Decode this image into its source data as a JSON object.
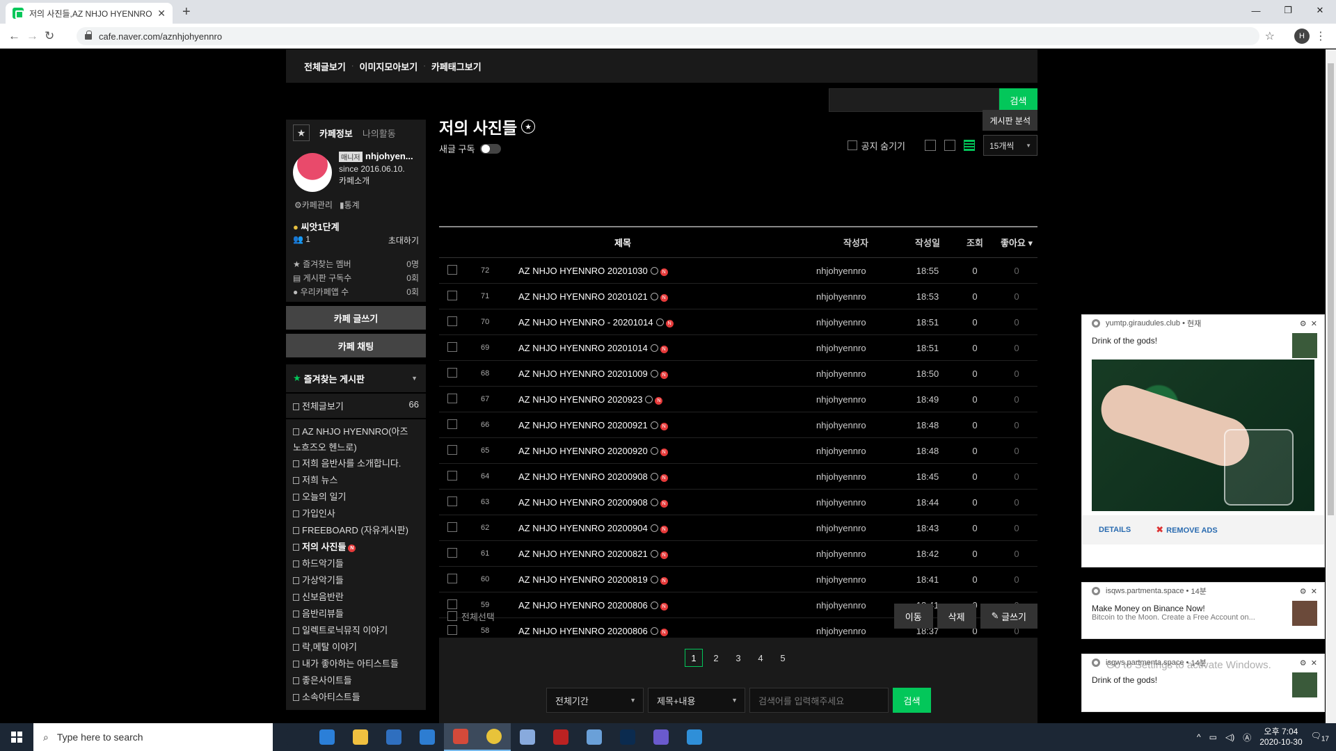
{
  "browser": {
    "tab_title": "저의 사진들,AZ NHJO HYENNRO",
    "url": "cafe.naver.com/aznhjohyennro",
    "profile_initial": "H"
  },
  "topmenu": [
    "전체글보기",
    "이미지모아보기",
    "카페태그보기"
  ],
  "top_search": {
    "button": "검색"
  },
  "sidebar": {
    "tab_info": "카페정보",
    "tab_activity": "나의활동",
    "manager_badge": "매니저",
    "manager_name": "nhjohyen...",
    "since": "since 2016.06.10.",
    "intro": "카페소개",
    "manage_link": "카페관리",
    "stats_link": "통계",
    "level": "씨앗1단계",
    "member_count": "1",
    "invite": "초대하기",
    "stats": [
      {
        "label": "즐겨찾는 멤버",
        "value": "0명"
      },
      {
        "label": "게시판 구독수",
        "value": "0회"
      },
      {
        "label": "우리카페앱 수",
        "value": "0회"
      }
    ],
    "write_button": "카페 글쓰기",
    "chat_button": "카페 채팅",
    "fav_title": "즐겨찾는 게시판",
    "all_posts": "전체글보기",
    "all_posts_count": "66",
    "boards": [
      "AZ NHJO HYENNRO(아즈 노흐즈오 헨느로)",
      "저희 음반사를 소개합니다.",
      "저희 뉴스",
      "오늘의 일기",
      "가입인사",
      "FREEBOARD (자유게시판)",
      "저의 사진들",
      "하드악기들",
      "가상악기들",
      "신보음반란",
      "음반리뷰들",
      "일렉트로닉뮤직 이야기",
      "락,메탈 이야기",
      "내가 좋아하는 아티스트들",
      "좋은사이트들",
      "소속아티스트들"
    ]
  },
  "main": {
    "board_title": "저의 사진들",
    "analysis_button": "게시판 분석",
    "subscribe_label": "새글 구독",
    "notice_hide": "공지 숨기기",
    "per_page": "15개씩",
    "headers": {
      "title": "제목",
      "author": "작성자",
      "date": "작성일",
      "views": "조회",
      "likes": "좋아요"
    },
    "rows": [
      {
        "num": "72",
        "title": "AZ NHJO HYENNRO 20201030",
        "author": "nhjohyennro",
        "date": "18:55",
        "views": "0",
        "likes": "0"
      },
      {
        "num": "71",
        "title": "AZ NHJO HYENNRO 20201021",
        "author": "nhjohyennro",
        "date": "18:53",
        "views": "0",
        "likes": "0"
      },
      {
        "num": "70",
        "title": "AZ NHJO HYENNRO - 20201014",
        "author": "nhjohyennro",
        "date": "18:51",
        "views": "0",
        "likes": "0"
      },
      {
        "num": "69",
        "title": "AZ NHJO HYENNRO 20201014",
        "author": "nhjohyennro",
        "date": "18:51",
        "views": "0",
        "likes": "0"
      },
      {
        "num": "68",
        "title": "AZ NHJO HYENNRO 20201009",
        "author": "nhjohyennro",
        "date": "18:50",
        "views": "0",
        "likes": "0"
      },
      {
        "num": "67",
        "title": "AZ NHJO HYENNRO 2020923",
        "author": "nhjohyennro",
        "date": "18:49",
        "views": "0",
        "likes": "0"
      },
      {
        "num": "66",
        "title": "AZ NHJO HYENNRO 20200921",
        "author": "nhjohyennro",
        "date": "18:48",
        "views": "0",
        "likes": "0"
      },
      {
        "num": "65",
        "title": "AZ NHJO HYENNRO 20200920",
        "author": "nhjohyennro",
        "date": "18:48",
        "views": "0",
        "likes": "0"
      },
      {
        "num": "64",
        "title": "AZ NHJO HYENNRO 20200908",
        "author": "nhjohyennro",
        "date": "18:45",
        "views": "0",
        "likes": "0"
      },
      {
        "num": "63",
        "title": "AZ NHJO HYENNRO 20200908",
        "author": "nhjohyennro",
        "date": "18:44",
        "views": "0",
        "likes": "0"
      },
      {
        "num": "62",
        "title": "AZ NHJO HYENNRO 20200904",
        "author": "nhjohyennro",
        "date": "18:43",
        "views": "0",
        "likes": "0"
      },
      {
        "num": "61",
        "title": "AZ NHJO HYENNRO 20200821",
        "author": "nhjohyennro",
        "date": "18:42",
        "views": "0",
        "likes": "0"
      },
      {
        "num": "60",
        "title": "AZ NHJO HYENNRO 20200819",
        "author": "nhjohyennro",
        "date": "18:41",
        "views": "0",
        "likes": "0"
      },
      {
        "num": "59",
        "title": "AZ NHJO HYENNRO 20200806",
        "author": "nhjohyennro",
        "date": "18:41",
        "views": "0",
        "likes": "0"
      },
      {
        "num": "58",
        "title": "AZ NHJO HYENNRO 20200806",
        "author": "nhjohyennro",
        "date": "18:37",
        "views": "0",
        "likes": "0"
      }
    ],
    "select_all": "전체선택",
    "move_button": "이동",
    "delete_button": "삭제",
    "write_button": "글쓰기",
    "pages": [
      "1",
      "2",
      "3",
      "4",
      "5"
    ],
    "current_page": "1",
    "period_select": "전체기간",
    "scope_select": "제목+내용",
    "search_placeholder": "검색어를 입력해주세요",
    "search_button": "검색"
  },
  "notifications": [
    {
      "site": "yumtp.giraudules.club",
      "time": "현재",
      "text": "Drink of the gods!",
      "details": "DETAILS",
      "remove": "REMOVE ADS"
    },
    {
      "site": "isqws.partmenta.space",
      "time": "14분",
      "text": "Make Money on Binance Now!",
      "subtext": "Bitcoin to the Moon. Create a Free Account on..."
    },
    {
      "site": "isqws.partmenta.space",
      "time": "14분",
      "text": "Drink of the gods!"
    }
  ],
  "watermark": "Go to Settings to activate Windows.",
  "taskbar": {
    "search_placeholder": "Type here to search",
    "time": "오후 7:04",
    "date": "2020-10-30",
    "notif_count": "17",
    "apps": [
      {
        "name": "task-view",
        "color": "#1c2735"
      },
      {
        "name": "edge",
        "color": "#2b7fd8"
      },
      {
        "name": "file-explorer",
        "color": "#f0c040"
      },
      {
        "name": "store",
        "color": "#2f6fbf"
      },
      {
        "name": "mail",
        "color": "#2d7dd2"
      },
      {
        "name": "app-red",
        "color": "#d44a3a"
      },
      {
        "name": "chrome",
        "color": "#e8c33a"
      },
      {
        "name": "notepad",
        "color": "#8ad"
      },
      {
        "name": "filezilla",
        "color": "#b22"
      },
      {
        "name": "app-globe",
        "color": "#6aa0d8"
      },
      {
        "name": "photoshop",
        "color": "#0b2b4f"
      },
      {
        "name": "app-bird",
        "color": "#6a5acd"
      },
      {
        "name": "ie",
        "color": "#2f8fd8"
      }
    ]
  }
}
